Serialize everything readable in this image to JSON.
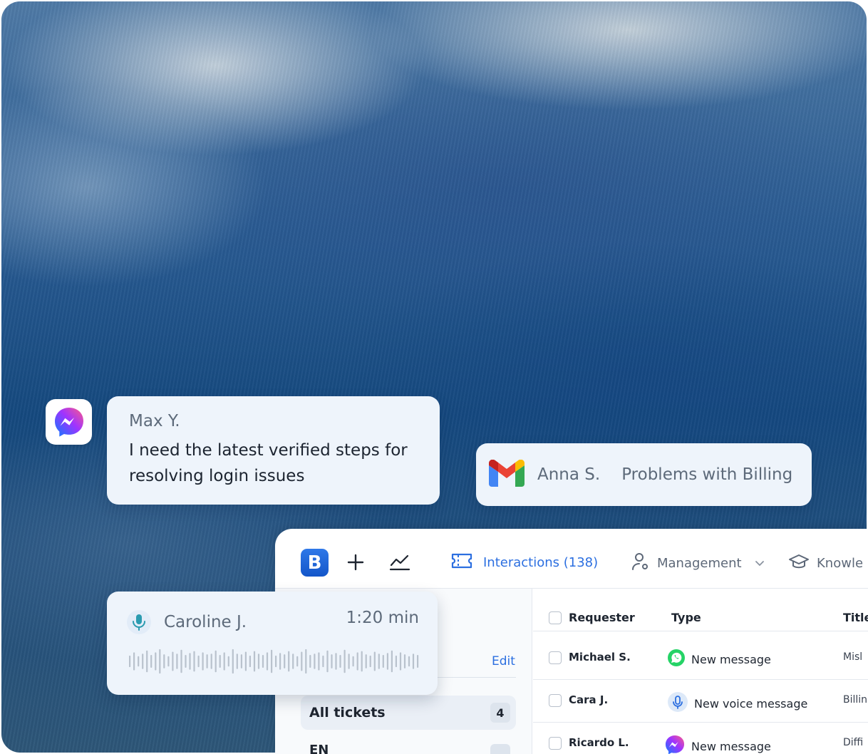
{
  "messenger_card": {
    "name": "Max Y.",
    "message": "I need the latest verified steps for resolving login issues"
  },
  "gmail_card": {
    "name": "Anna S.",
    "subject": "Problems with Billing"
  },
  "voice_card": {
    "name": "Caroline J.",
    "duration": "1:20 min",
    "waveform_levels": [
      0.45,
      0.7,
      0.4,
      0.6,
      0.85,
      0.5,
      0.7,
      0.95,
      0.55,
      0.4,
      0.75,
      0.6,
      0.9,
      0.5,
      0.65,
      0.8,
      0.45,
      0.7,
      0.55,
      0.6,
      0.85,
      0.5,
      0.7,
      0.4,
      0.95,
      0.6,
      0.55,
      0.75,
      0.45,
      0.8,
      0.6,
      0.5,
      0.7,
      0.9,
      0.45,
      0.65,
      0.55,
      0.8,
      0.6,
      0.4,
      0.75,
      0.95,
      0.5,
      0.6,
      0.7,
      0.45,
      0.85,
      0.55,
      0.65,
      0.5,
      0.9,
      0.6,
      0.4,
      0.7,
      0.8,
      0.55,
      0.45,
      0.75,
      0.6,
      0.5,
      0.65,
      0.85,
      0.45,
      0.7,
      0.55,
      0.4,
      0.6,
      0.5
    ]
  },
  "app": {
    "logo_letter": "B",
    "toolbar": {
      "interactions_label": "Interactions (138)",
      "management_label": "Management",
      "knowledge_label": "Knowle"
    },
    "sidebar": {
      "edit_label": "Edit",
      "all_tickets_label": "All tickets",
      "all_tickets_count": "4",
      "en_label": "EN"
    },
    "table": {
      "headers": {
        "requester": "Requester",
        "type": "Type",
        "title": "Title"
      },
      "rows": [
        {
          "requester": "Michael S.",
          "type": "New message",
          "type_icon": "whatsapp-icon",
          "title": "Misl"
        },
        {
          "requester": "Cara J.",
          "type": "New voice message",
          "type_icon": "mic-icon",
          "title": "Billin"
        },
        {
          "requester": "Ricardo L.",
          "type": "New message",
          "type_icon": "messenger-icon",
          "title": "Diffi"
        }
      ]
    }
  },
  "colors": {
    "accent": "#2c6fe0",
    "card_bg": "#eef4fb",
    "whatsapp": "#25d366"
  }
}
